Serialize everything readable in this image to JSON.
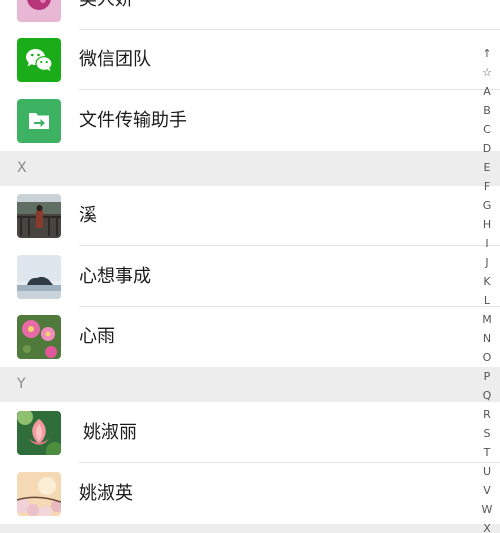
{
  "contacts": {
    "top_partial_name": "美人娇",
    "rows": [
      {
        "name": "微信团队",
        "avatar_icon": "wechat-icon"
      },
      {
        "name": "文件传输助手",
        "avatar_icon": "file-transfer-icon"
      },
      {
        "name": "溪",
        "avatar_icon": "photo-balcony"
      },
      {
        "name": "心想事成",
        "avatar_icon": "photo-sea-island"
      },
      {
        "name": "心雨",
        "avatar_icon": "photo-pink-flowers"
      },
      {
        "name": "姚淑丽",
        "avatar_icon": "photo-lotus"
      },
      {
        "name": "姚淑英",
        "avatar_icon": "photo-blossom-sunset"
      }
    ],
    "sections": [
      "X",
      "Y"
    ]
  },
  "index_bar": [
    "↑",
    "☆",
    "A",
    "B",
    "C",
    "D",
    "E",
    "F",
    "G",
    "H",
    "I",
    "J",
    "K",
    "L",
    "M",
    "N",
    "O",
    "P",
    "Q",
    "R",
    "S",
    "T",
    "U",
    "V",
    "W",
    "X"
  ],
  "colors": {
    "wechat_green": "#1AAD19",
    "file_green": "#3CB262",
    "section_bg": "#EDEDED",
    "divider": "#E4E4E4"
  }
}
